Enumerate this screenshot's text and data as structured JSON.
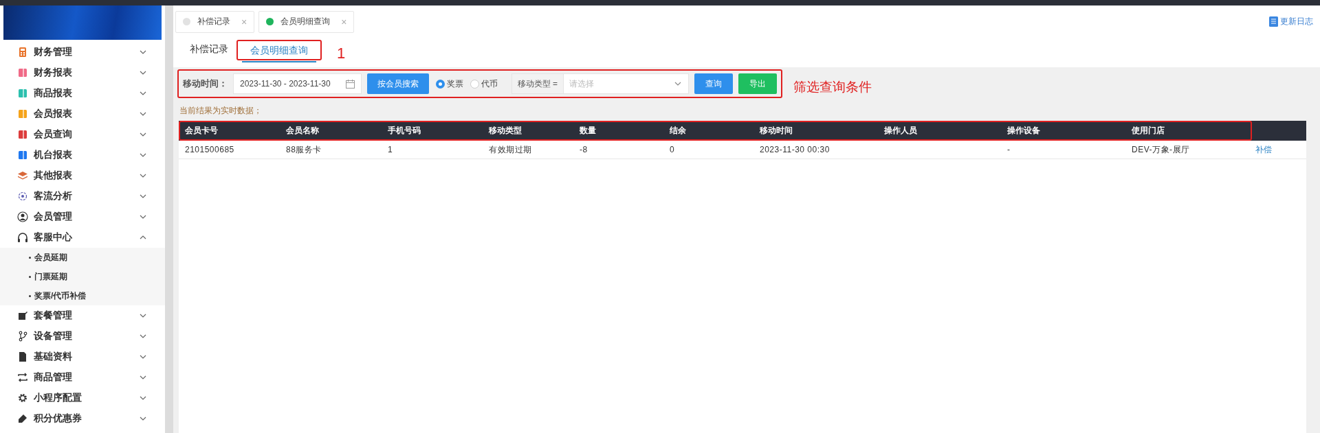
{
  "sidebar": {
    "items": [
      {
        "label": "财务管理",
        "kind": "calculator",
        "expanded": false
      },
      {
        "label": "财务报表",
        "kind": "book",
        "color": "#f06a87",
        "expanded": false
      },
      {
        "label": "商品报表",
        "kind": "book",
        "color": "#2cc0ae",
        "expanded": false
      },
      {
        "label": "会员报表",
        "kind": "book",
        "color": "#f5a31a",
        "expanded": false
      },
      {
        "label": "会员查询",
        "kind": "book",
        "color": "#dc3c3c",
        "expanded": false
      },
      {
        "label": "机台报表",
        "kind": "book",
        "color": "#1f78f0",
        "expanded": false
      },
      {
        "label": "其他报表",
        "kind": "layers",
        "expanded": false
      },
      {
        "label": "客流分析",
        "kind": "target",
        "expanded": false
      },
      {
        "label": "会员管理",
        "kind": "user",
        "expanded": false
      },
      {
        "label": "客服中心",
        "kind": "headset",
        "expanded": true,
        "children": [
          {
            "label": "会员延期"
          },
          {
            "label": "门票延期"
          },
          {
            "label": "奖票/代币补偿"
          }
        ]
      },
      {
        "label": "套餐管理",
        "kind": "edit",
        "expanded": false
      },
      {
        "label": "设备管理",
        "kind": "branch",
        "expanded": false
      },
      {
        "label": "基础资料",
        "kind": "file",
        "expanded": false
      },
      {
        "label": "商品管理",
        "kind": "swap",
        "expanded": false
      },
      {
        "label": "小程序配置",
        "kind": "gear",
        "expanded": false
      },
      {
        "label": "积分优惠券",
        "kind": "tag",
        "expanded": false
      }
    ]
  },
  "page_tabs": [
    {
      "label": "补偿记录",
      "selected": false,
      "close": "×"
    },
    {
      "label": "会员明细查询",
      "selected": true,
      "close": "×"
    }
  ],
  "update_log": "更新日志",
  "sub_tabs": {
    "items": [
      {
        "label": "补偿记录",
        "selected": false
      },
      {
        "label": "会员明细查询",
        "selected": true
      }
    ],
    "annotation_box": true,
    "annotation_label": "1"
  },
  "filter": {
    "annotation_box": true,
    "annotation_label": "筛选查询条件",
    "time_label": "移动时间：",
    "date_range": "2023-11-30 - 2023-11-30",
    "member_search_button": "按会员搜索",
    "radios": [
      {
        "label": "奖票",
        "selected": true
      },
      {
        "label": "代币",
        "selected": false
      }
    ],
    "type_label": "移动类型 =",
    "type_placeholder": "请选择",
    "query_button": "查询",
    "export_button": "导出"
  },
  "notice": "当前结果为实时数据；",
  "table": {
    "header_annotation_box": true,
    "columns": [
      "会员卡号",
      "会员名称",
      "手机号码",
      "移动类型",
      "数量",
      "结余",
      "移动时间",
      "操作人员",
      "操作设备",
      "使用门店"
    ],
    "rows": [
      {
        "cells": [
          "2101500685",
          "88服务卡",
          "1",
          "有效期过期",
          "-8",
          "0",
          "2023-11-30 00:30",
          "",
          "-",
          "DEV-万象-展厅"
        ],
        "action": "补偿"
      }
    ]
  }
}
